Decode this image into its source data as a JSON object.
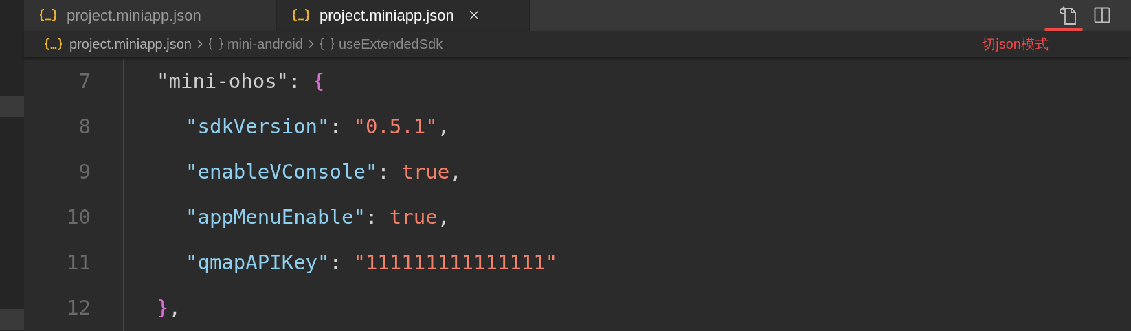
{
  "tabs": [
    {
      "label": "project.miniapp.json",
      "selected": false
    },
    {
      "label": "project.miniapp.json",
      "selected": true
    }
  ],
  "breadcrumb": [
    {
      "kind": "file",
      "label": "project.miniapp.json"
    },
    {
      "kind": "object",
      "label": "mini-android"
    },
    {
      "kind": "object",
      "label": "useExtendedSdk"
    }
  ],
  "annotation": {
    "text": "切json模式"
  },
  "lines": [
    {
      "number": "7",
      "tokens": [
        {
          "kind": "outer_key",
          "text": "\"mini-ohos\""
        },
        {
          "kind": "punct",
          "text": ": "
        },
        {
          "kind": "bracket",
          "text": "{"
        }
      ],
      "children": [
        {
          "number": "8",
          "tokens": [
            {
              "kind": "key",
              "text": "\"sdkVersion\""
            },
            {
              "kind": "punct",
              "text": ": "
            },
            {
              "kind": "string",
              "text": "\"0.5.1\""
            },
            {
              "kind": "punct",
              "text": ","
            }
          ]
        },
        {
          "number": "9",
          "tokens": [
            {
              "kind": "key",
              "text": "\"enableVConsole\""
            },
            {
              "kind": "punct",
              "text": ": "
            },
            {
              "kind": "literal",
              "text": "true"
            },
            {
              "kind": "punct",
              "text": ","
            }
          ]
        },
        {
          "number": "10",
          "tokens": [
            {
              "kind": "key",
              "text": "\"appMenuEnable\""
            },
            {
              "kind": "punct",
              "text": ": "
            },
            {
              "kind": "literal",
              "text": "true"
            },
            {
              "kind": "punct",
              "text": ","
            }
          ]
        },
        {
          "number": "11",
          "tokens": [
            {
              "kind": "key",
              "text": "\"qmapAPIKey\""
            },
            {
              "kind": "punct",
              "text": ": "
            },
            {
              "kind": "string",
              "text": "\"111111111111111\""
            }
          ]
        }
      ]
    },
    {
      "number": "12",
      "tokens": [
        {
          "kind": "bracket",
          "text": "}"
        },
        {
          "kind": "punct",
          "text": ","
        }
      ]
    }
  ]
}
